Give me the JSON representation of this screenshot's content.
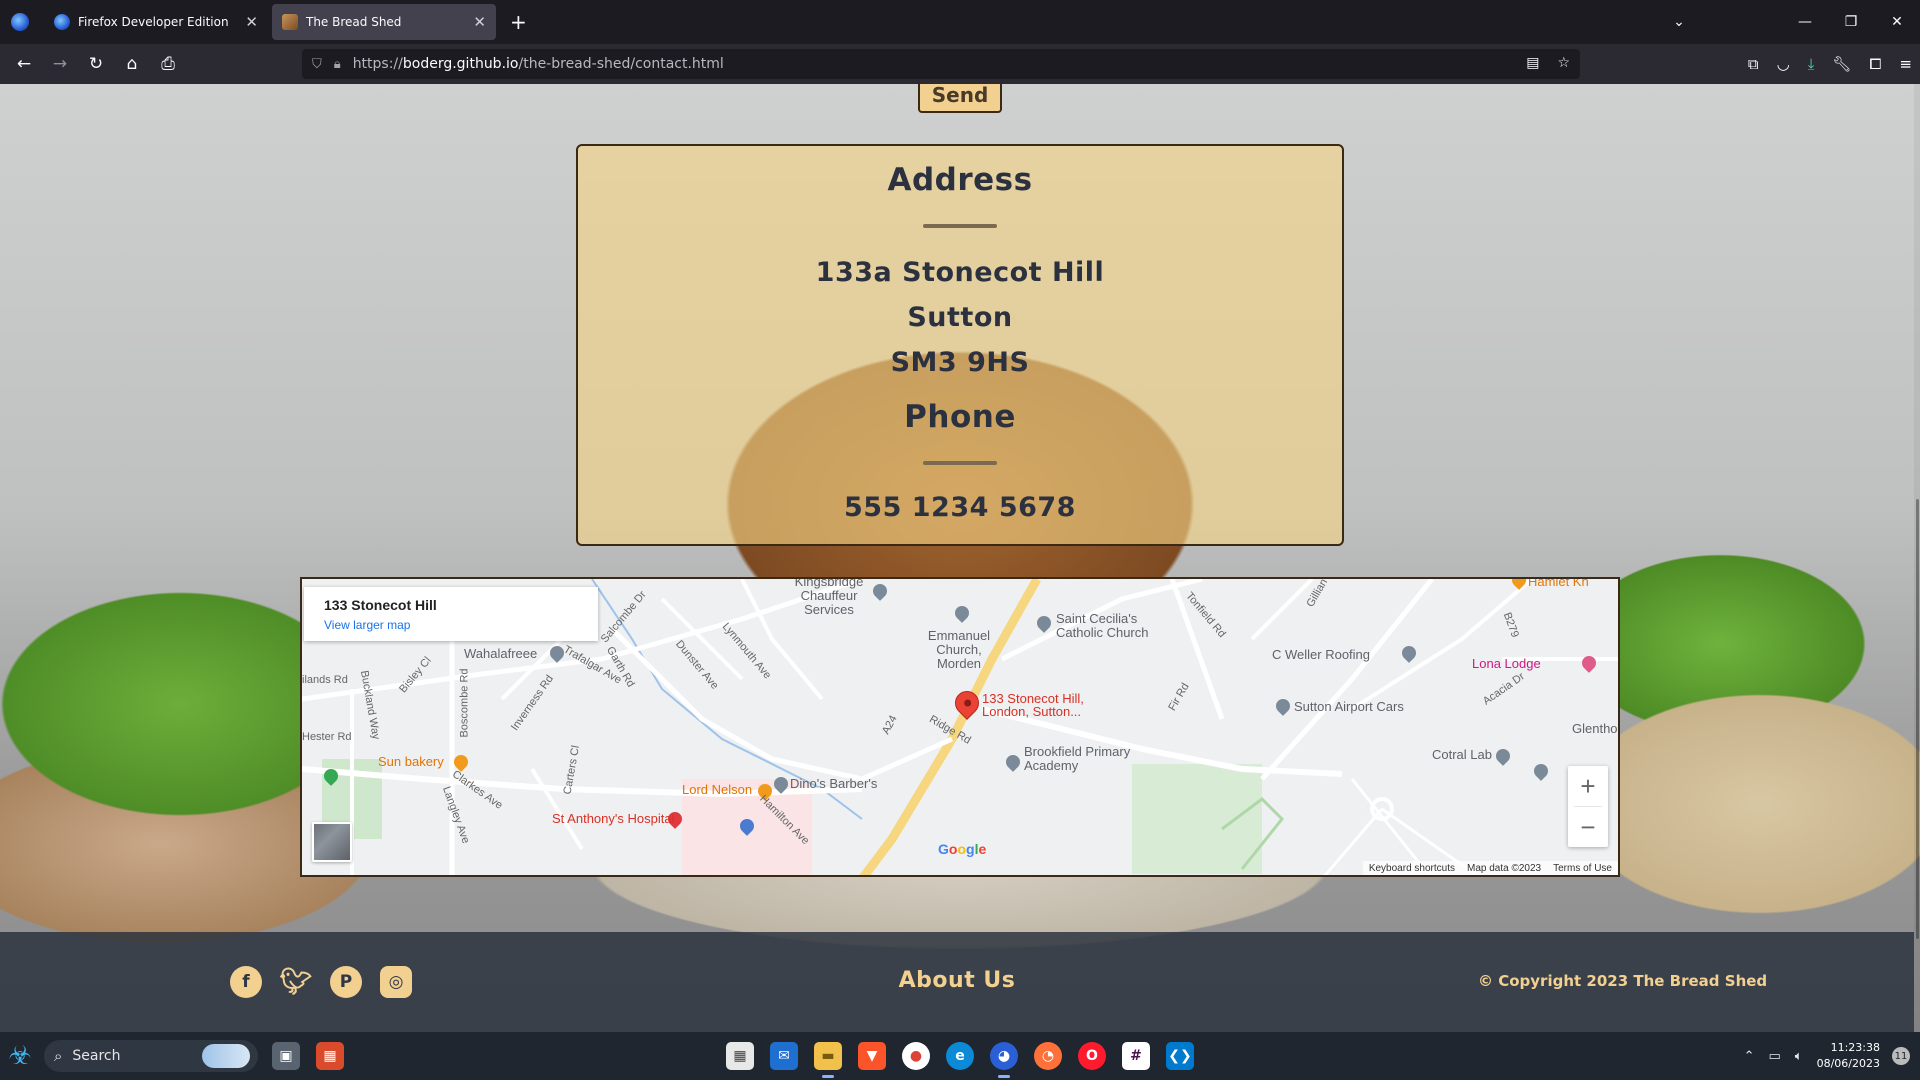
{
  "browser": {
    "tabs": [
      {
        "title": "Firefox Developer Edition",
        "active": false
      },
      {
        "title": "The Bread Shed",
        "active": true
      }
    ],
    "url_prefix": "https://",
    "url_host": "boderg.github.io",
    "url_path": "/the-bread-shed/contact.html",
    "icons": [
      "back-icon",
      "forward-icon",
      "reload-icon",
      "home-icon",
      "print-icon",
      "shield-icon",
      "lock-icon",
      "reader-icon",
      "bookmark-star-icon",
      "screenshot-icon",
      "pocket-icon",
      "download-icon",
      "wrench-icon",
      "extensions-icon",
      "menu-icon"
    ]
  },
  "page": {
    "send_label": "Send",
    "address_heading": "Address",
    "address_lines": [
      "133a Stonecot Hill",
      "Sutton",
      "SM3 9HS"
    ],
    "phone_heading": "Phone",
    "phone_number": "555 1234 5678"
  },
  "map": {
    "card_title": "133 Stonecot Hill",
    "card_link": "View larger map",
    "pin_label": "133 Stonecot Hill, London, Sutton...",
    "labels": {
      "kingsbridge": "Kingsbridge Chauffeur Services",
      "emmanuel": "Emmanuel Church, Morden",
      "saint_cecilia": "Saint Cecilia's Catholic Church",
      "c_weller": "C Weller Roofing",
      "lona": "Lona Lodge",
      "wahalafreee": "Wahalafreee",
      "sutton_airport": "Sutton Airport Cars",
      "sun_bakery": "Sun bakery",
      "brookfield": "Brookfield Primary Academy",
      "cotral": "Cotral Lab",
      "dinos": "Dino's Barber's",
      "lord_nelson": "Lord Nelson",
      "st_anthony": "St Anthony's Hospital",
      "glenthorne": "Glentho",
      "hamlet": "Hamlet Kn"
    },
    "roads": [
      "A24",
      "Salcombe Dr",
      "Lynmouth Ave",
      "Dunster Ave",
      "Trafalgar Ave",
      "Garth Rd",
      "Ridge Rd",
      "Tonfield Rd",
      "Gillian",
      "B279",
      "Acacia Dr",
      "Fir Rd",
      "Bisley Cl",
      "Buckland Way",
      "Boscombe Rd",
      "Inverness Rd",
      "Carters Cl",
      "Clarkes Ave",
      "Langley Ave",
      "Hamilton Ave",
      "Hester Rd",
      "ilands Rd"
    ],
    "google_logo": "Google",
    "footer": [
      "Keyboard shortcuts",
      "Map data ©2023",
      "Terms of Use"
    ]
  },
  "footer": {
    "social": [
      "facebook-icon",
      "twitter-icon",
      "pinterest-icon",
      "instagram-icon"
    ],
    "about": "About Us",
    "copyright": "© Copyright 2023 The Bread Shed"
  },
  "taskbar": {
    "search": "Search",
    "time": "11:23:38",
    "date": "08/06/2023",
    "notifications": "11"
  },
  "colors": {
    "accent": "#f2d08f",
    "card": "#f6d484",
    "footer_bg": "#28303c",
    "text_dark": "#2c3140"
  }
}
